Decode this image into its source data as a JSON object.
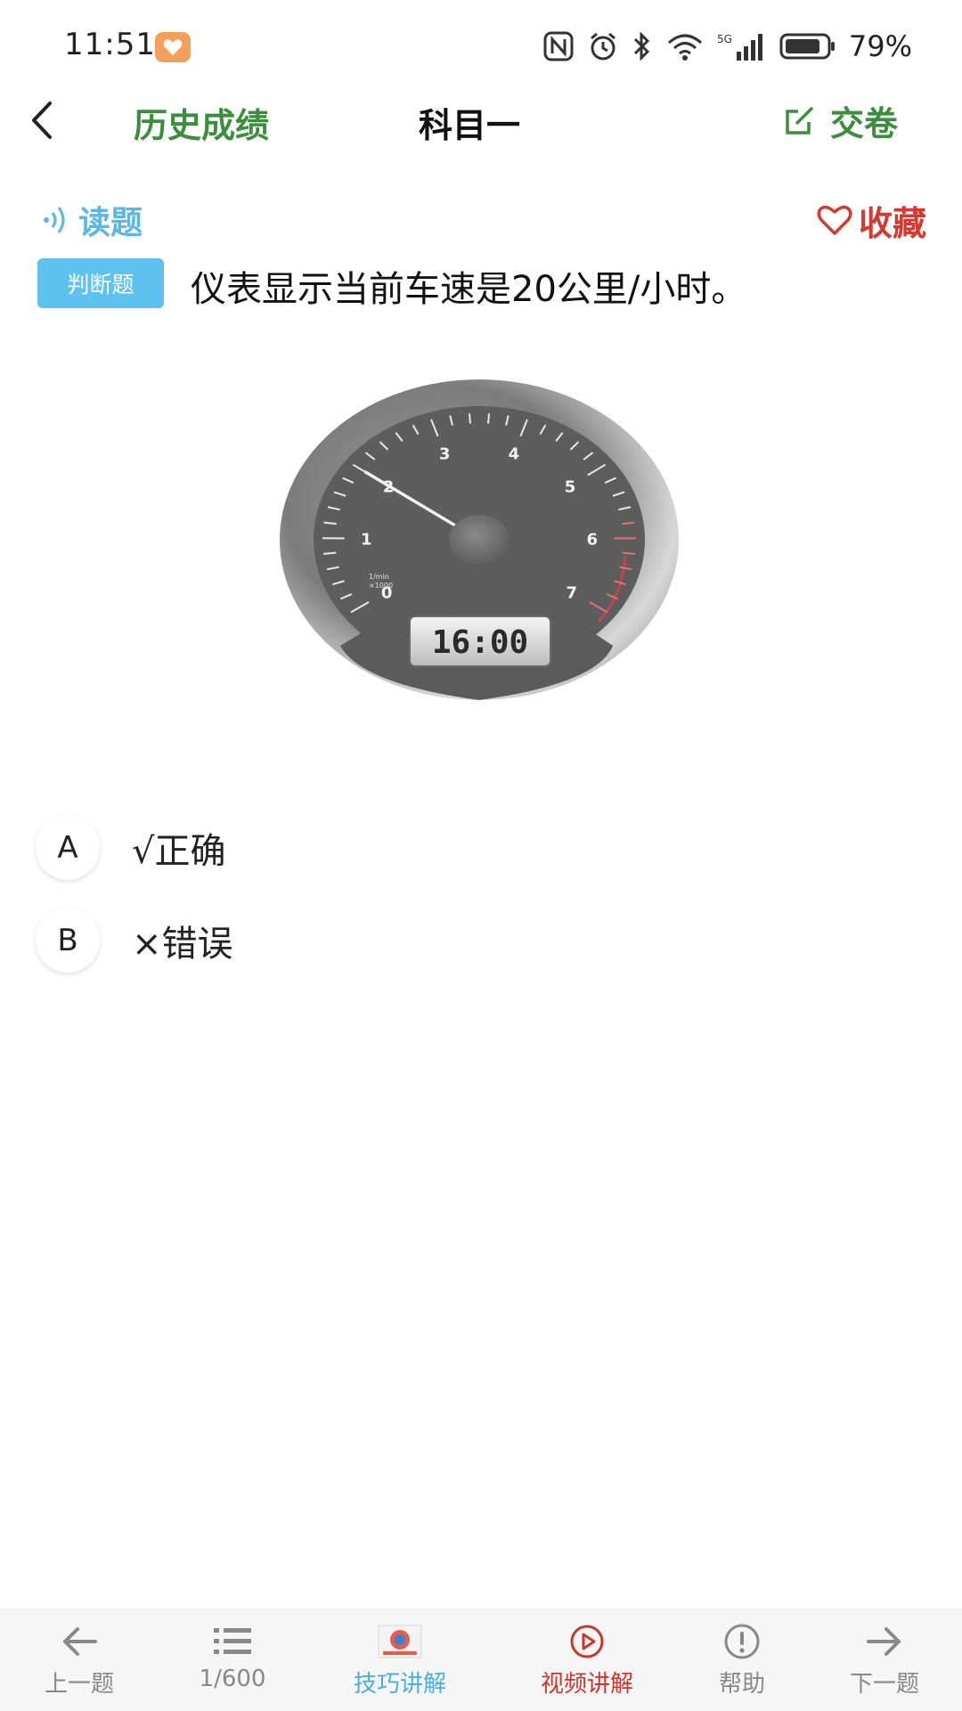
{
  "status_bar": {
    "time": "11:51",
    "battery": "79%",
    "network": "5G"
  },
  "nav": {
    "history_label": "历史成绩",
    "title": "科目一",
    "submit_label": "交卷"
  },
  "toolbar": {
    "read_label": "读题",
    "favorite_label": "收藏"
  },
  "question": {
    "type_tag": "判断题",
    "text": "仪表显示当前车速是20公里/小时。",
    "image": {
      "display": "16:00",
      "scale_numbers": [
        "0",
        "1",
        "2",
        "3",
        "4",
        "5",
        "6",
        "7"
      ],
      "unit_lines": [
        "1/min",
        "×1000"
      ],
      "needle_value": 2
    }
  },
  "options": [
    {
      "letter": "A",
      "text": "√正确"
    },
    {
      "letter": "B",
      "text": "×错误"
    }
  ],
  "bottom_tabs": [
    {
      "label": "上一题",
      "icon": "arrow-left-icon",
      "color": "#888888"
    },
    {
      "label": "1/600",
      "icon": "list-icon",
      "color": "#888888"
    },
    {
      "label": "技巧讲解",
      "icon": "tips-image-icon",
      "color": "#4aaee0"
    },
    {
      "label": "视频讲解",
      "icon": "play-icon",
      "color": "#c8382e"
    },
    {
      "label": "帮助",
      "icon": "help-icon",
      "color": "#888888"
    },
    {
      "label": "下一题",
      "icon": "arrow-right-icon",
      "color": "#888888"
    }
  ],
  "colors": {
    "accent_green": "#3c8e3e",
    "read_blue": "#5bb7e6",
    "favorite_red": "#d43a2f",
    "tag_blue": "#5ec1ee"
  }
}
